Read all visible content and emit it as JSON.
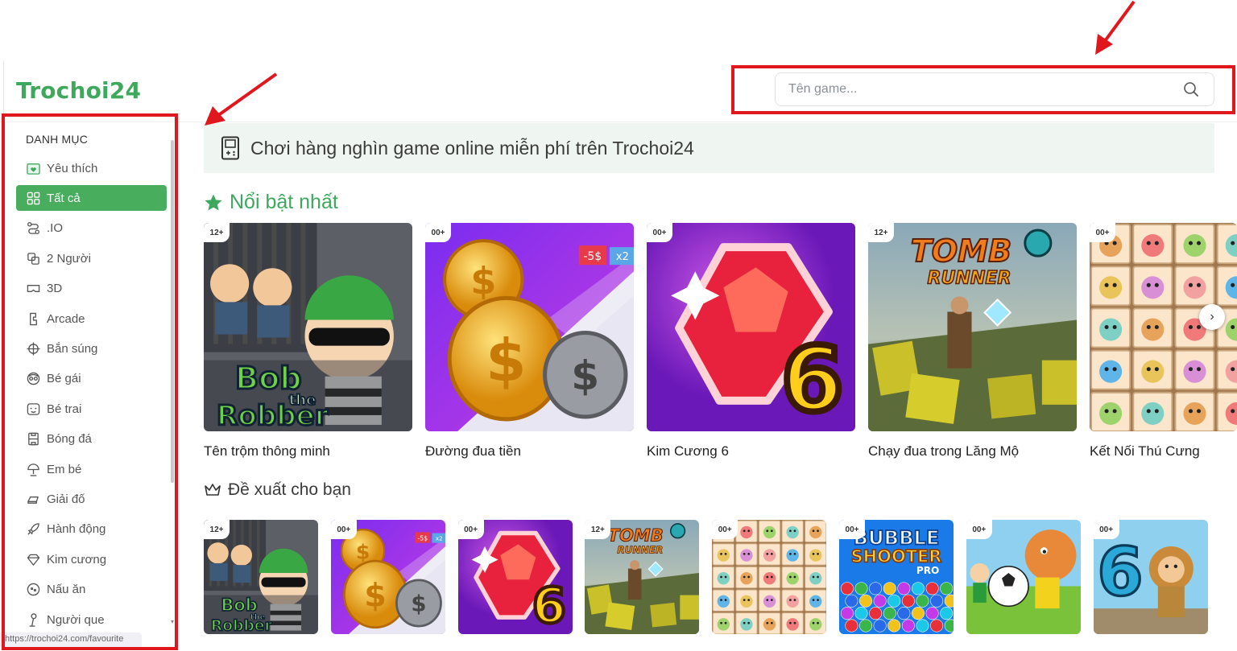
{
  "brand": {
    "logo": "Trochoi24"
  },
  "search": {
    "placeholder": "Tên game..."
  },
  "sidebar": {
    "title": "DANH MỤC",
    "items": [
      {
        "label": "Yêu thích",
        "icon": "heart-folder-icon",
        "active": false
      },
      {
        "label": "Tất cả",
        "icon": "grid-icon",
        "active": true
      },
      {
        "label": ".IO",
        "icon": "route-icon",
        "active": false
      },
      {
        "label": "2 Người",
        "icon": "two-squares-icon",
        "active": false
      },
      {
        "label": "3D",
        "icon": "vr-headset-icon",
        "active": false
      },
      {
        "label": "Arcade",
        "icon": "arcade-icon",
        "active": false
      },
      {
        "label": "Bắn súng",
        "icon": "crosshair-icon",
        "active": false
      },
      {
        "label": "Bé gái",
        "icon": "girl-face-icon",
        "active": false
      },
      {
        "label": "Bé trai",
        "icon": "boy-face-icon",
        "active": false
      },
      {
        "label": "Bóng đá",
        "icon": "soccer-field-icon",
        "active": false
      },
      {
        "label": "Em bé",
        "icon": "baby-icon",
        "active": false
      },
      {
        "label": "Giải đố",
        "icon": "puzzle-icon",
        "active": false
      },
      {
        "label": "Hành động",
        "icon": "rocket-icon",
        "active": false
      },
      {
        "label": "Kim cương",
        "icon": "diamond-icon",
        "active": false
      },
      {
        "label": "Nấu ăn",
        "icon": "cooking-icon",
        "active": false
      },
      {
        "label": "Người que",
        "icon": "stickman-icon",
        "active": false
      }
    ],
    "status_url": "https://trochoi24.com/favourite"
  },
  "banner": {
    "text": "Chơi hàng nghìn game online miễn phí trên Trochoi24",
    "icon": "gamepad-icon"
  },
  "featured": {
    "title": "Nổi bật nhất",
    "icon": "star-icon",
    "games": [
      {
        "title": "Tên trộm thông minh",
        "badge": "12+",
        "art": "bob",
        "art_text": "Bob the Robber"
      },
      {
        "title": "Đường đua tiền",
        "badge": "00+",
        "art": "coins",
        "art_text": "-5$",
        "art_text2": "x2"
      },
      {
        "title": "Kim Cương 6",
        "badge": "00+",
        "art": "gem",
        "art_text": "6"
      },
      {
        "title": "Chạy đua trong Lăng Mộ",
        "badge": "12+",
        "art": "tomb",
        "art_text": "TOMB",
        "art_text2": "RUNNER"
      },
      {
        "title": "Kết Nối Thú Cưng",
        "badge": "00+",
        "art": "pets"
      }
    ]
  },
  "recommend": {
    "title": "Đề xuất cho bạn",
    "icon": "crown-icon",
    "games": [
      {
        "badge": "12+",
        "art": "bob",
        "art_text": "Bob the Robber"
      },
      {
        "badge": "00+",
        "art": "coins",
        "art_text": "-5$"
      },
      {
        "badge": "00+",
        "art": "gem",
        "art_text": "6"
      },
      {
        "badge": "12+",
        "art": "tomb",
        "art_text": "TOMB",
        "art_text2": "RUNNER"
      },
      {
        "badge": "00+",
        "art": "pets"
      },
      {
        "badge": "00+",
        "art": "bubble",
        "art_text": "BUBBLE",
        "art_text2": "SHOOTER",
        "art_text3": "PRO"
      },
      {
        "badge": "00+",
        "art": "soccer"
      },
      {
        "badge": "00+",
        "art": "adam",
        "art_text": "6"
      }
    ]
  },
  "colors": {
    "brand": "#3ea85c",
    "active": "#48ad5d",
    "annotation": "#e0181e"
  }
}
